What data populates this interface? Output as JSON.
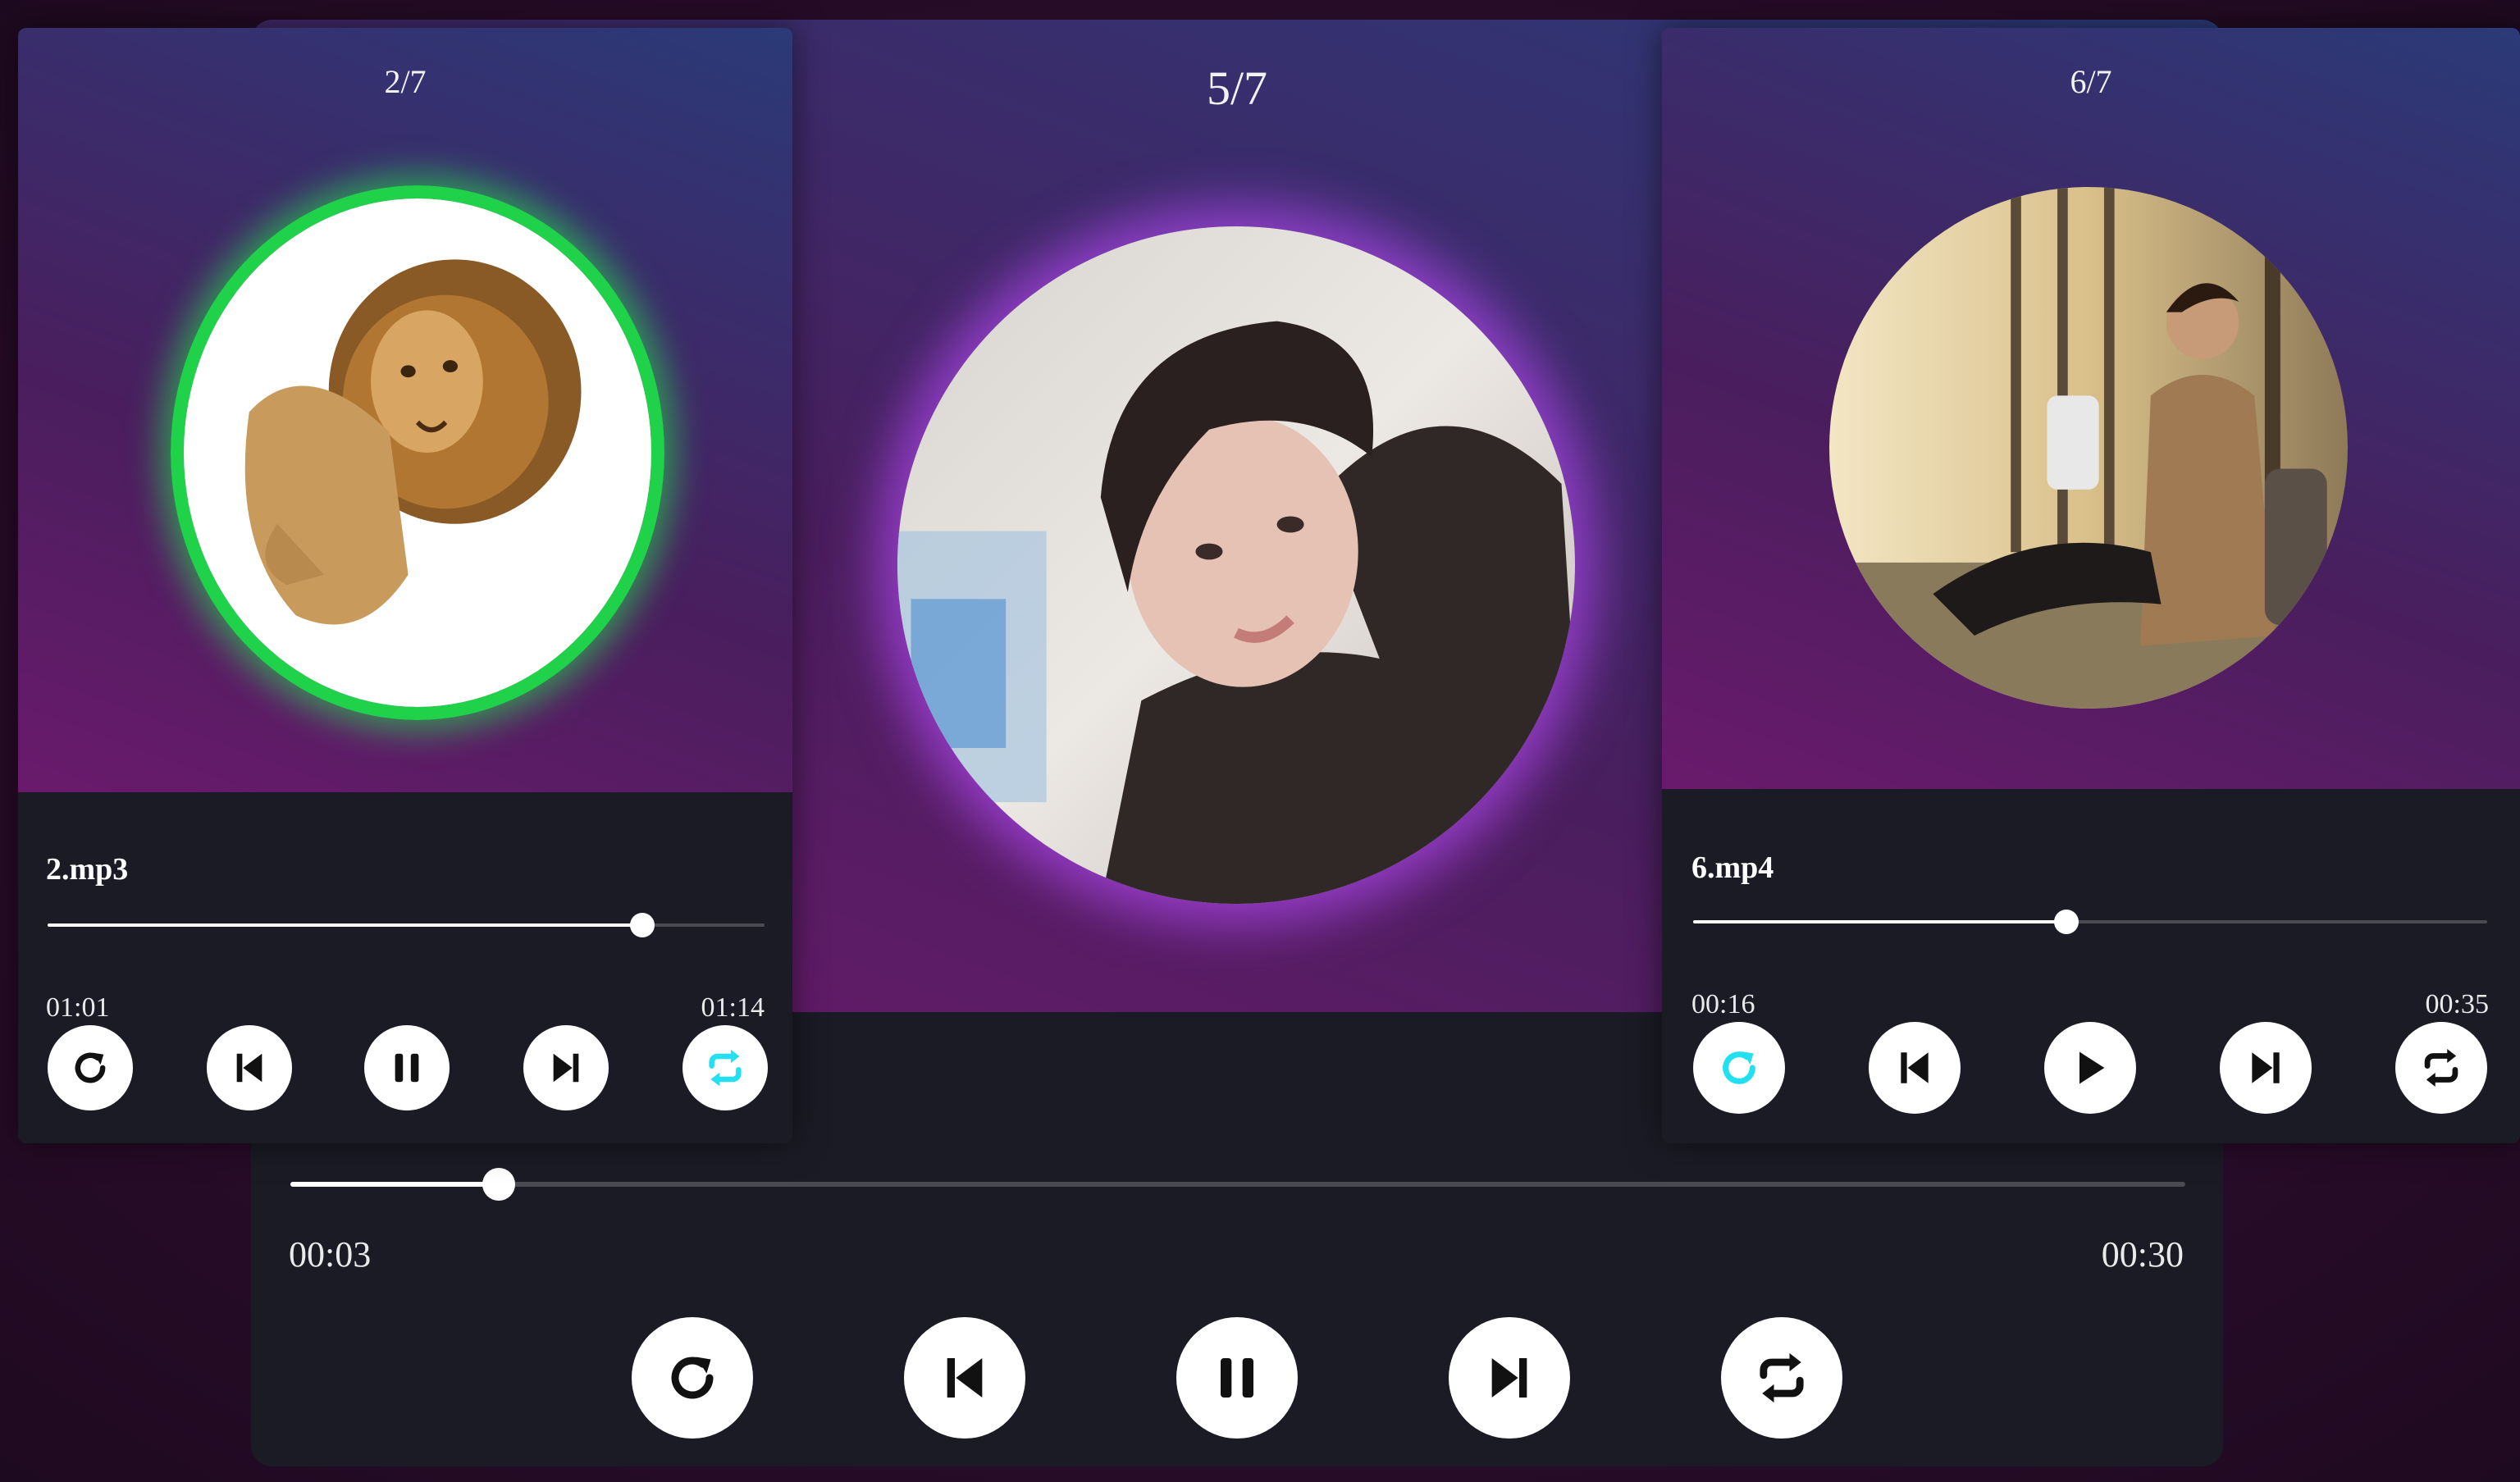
{
  "colors": {
    "accent_active": "#22e0f0",
    "card_bottom": "#1b1b26",
    "left_glow": "#1fd24a",
    "main_glow": "#a040e0"
  },
  "main_player": {
    "counter": "5/7",
    "artwork": "portrait-photo",
    "progress": 0.11,
    "elapsed": "00:03",
    "duration": "00:30",
    "controls": [
      "repeat-one-icon",
      "previous-icon",
      "pause-icon",
      "next-icon",
      "repeat-icon"
    ]
  },
  "left_player": {
    "counter": "2/7",
    "artwork": "lion-photo",
    "title": "2.mp3",
    "progress": 0.83,
    "elapsed": "01:01",
    "duration": "01:14",
    "controls": [
      "repeat-one-icon",
      "previous-icon",
      "pause-icon",
      "next-icon",
      "repeat-icon-active"
    ]
  },
  "right_player": {
    "counter": "6/7",
    "artwork": "man-with-phone-photo",
    "title": "6.mp4",
    "progress": 0.47,
    "elapsed": "00:16",
    "duration": "00:35",
    "controls": [
      "repeat-one-icon-active",
      "previous-icon",
      "play-icon",
      "next-icon",
      "repeat-icon"
    ]
  }
}
